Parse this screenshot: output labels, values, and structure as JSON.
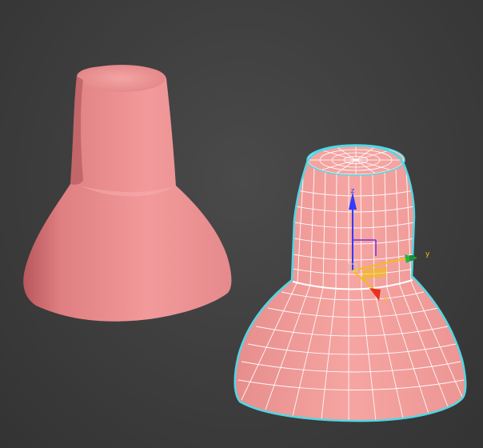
{
  "viewport": {
    "background": "#3c3c3c"
  },
  "objects": [
    {
      "name": "sculpted-object",
      "style": "smooth-shaded",
      "color": "#e8898a"
    },
    {
      "name": "selected-mesh-object",
      "style": "wireframe-on-shaded",
      "color": "#f09a98",
      "wire_color": "#ffffff",
      "selection_outline": "#4fd8e6"
    }
  ],
  "gizmo": {
    "axes": {
      "z": {
        "label": "z",
        "color": "#2f3cff"
      },
      "y": {
        "label": "y",
        "color": "#27b24a"
      },
      "x": {
        "label": "x",
        "color": "#e8321e"
      }
    },
    "plane_color": "#f2c200"
  }
}
